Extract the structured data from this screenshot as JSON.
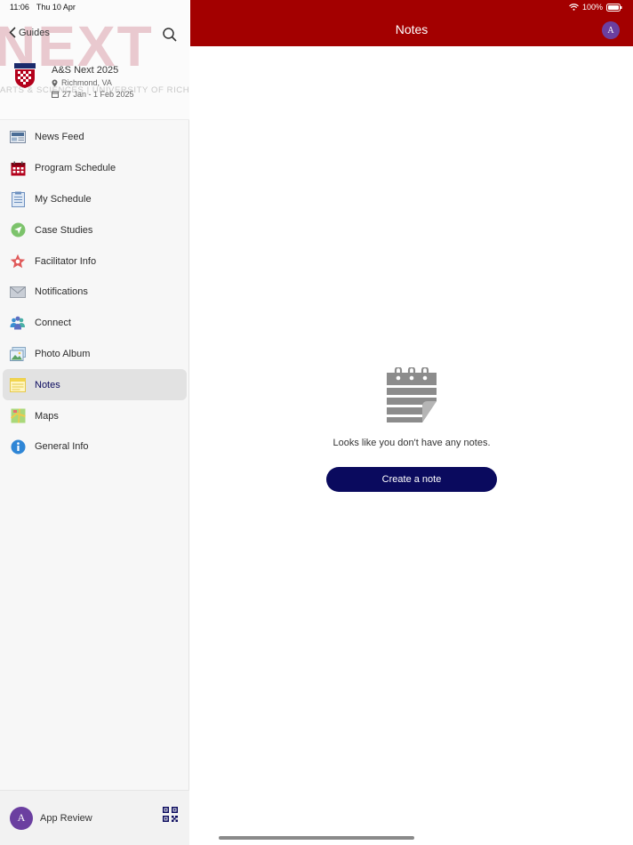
{
  "status_bar": {
    "time": "11:06",
    "date": "Thu 10 Apr",
    "battery": "100%"
  },
  "sidebar": {
    "back_label": "Guides",
    "hero_text": "NEXT",
    "hero_subtitle": "ARTS & SCIENCES | UNIVERSITY OF RICHMOND",
    "event_title": "A&S Next 2025",
    "event_location": "Richmond, VA",
    "event_dates": "27 Jan - 1 Feb 2025",
    "items": [
      {
        "label": "News Feed",
        "icon": "news-feed-icon"
      },
      {
        "label": "Program Schedule",
        "icon": "calendar-icon"
      },
      {
        "label": "My Schedule",
        "icon": "clipboard-icon"
      },
      {
        "label": "Case Studies",
        "icon": "location-arrow-icon"
      },
      {
        "label": "Facilitator Info",
        "icon": "star-icon"
      },
      {
        "label": "Notifications",
        "icon": "envelope-icon"
      },
      {
        "label": "Connect",
        "icon": "people-icon"
      },
      {
        "label": "Photo Album",
        "icon": "photo-icon"
      },
      {
        "label": "Notes",
        "icon": "notes-icon",
        "active": true
      },
      {
        "label": "Maps",
        "icon": "map-icon"
      },
      {
        "label": "General Info",
        "icon": "info-icon"
      }
    ],
    "footer": {
      "avatar_initial": "A",
      "user_name": "App Review"
    }
  },
  "main": {
    "title": "Notes",
    "avatar_initial": "A",
    "empty_text": "Looks like you don't have any notes.",
    "create_button": "Create a note"
  },
  "colors": {
    "header_bg": "#a30000",
    "button_bg": "#0a0a5e",
    "avatar_bg": "#6b3fa0",
    "active_item_bg": "#e2e2e2"
  }
}
